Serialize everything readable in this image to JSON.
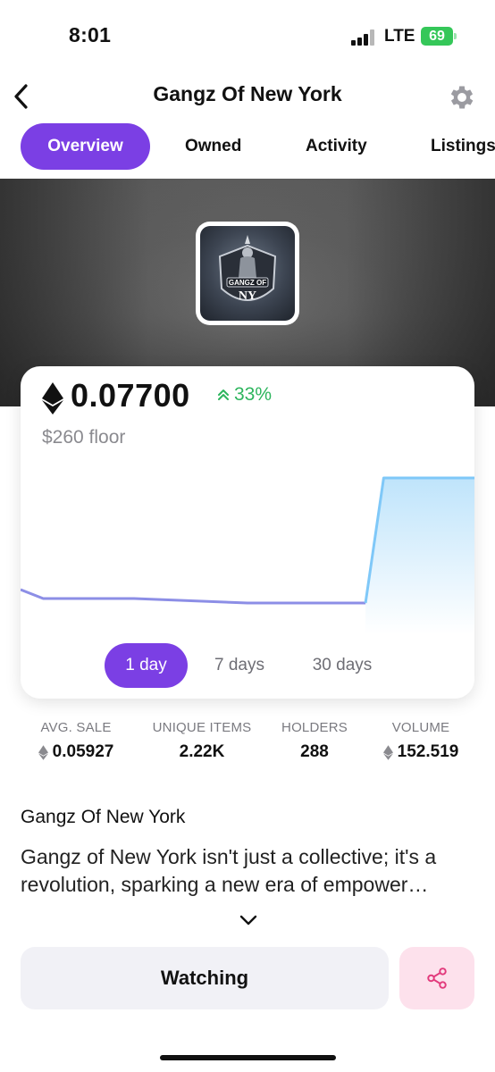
{
  "status_bar": {
    "time": "8:01",
    "network": "LTE",
    "battery": "69"
  },
  "header": {
    "title": "Gangz Of New York",
    "back_icon": "chevron-left-icon",
    "settings_icon": "gear-icon"
  },
  "tabs": [
    {
      "label": "Overview",
      "active": true
    },
    {
      "label": "Owned",
      "active": false
    },
    {
      "label": "Activity",
      "active": false
    },
    {
      "label": "Listings",
      "active": false
    }
  ],
  "collection": {
    "logo_text_line1": "GANGZ OF",
    "logo_text_line2": "NY"
  },
  "price": {
    "currency_icon": "ethereum-icon",
    "value": "0.07700",
    "change": "33%",
    "change_direction": "up",
    "change_color": "#2db55d",
    "floor_usd": "$260 floor"
  },
  "chart_data": {
    "type": "area",
    "x": [
      0,
      0.05,
      0.25,
      0.5,
      0.76,
      0.8,
      1.0
    ],
    "y": [
      0.0745,
      0.0743,
      0.0743,
      0.0742,
      0.0742,
      0.077,
      0.077
    ],
    "title": "",
    "xlabel": "",
    "ylabel": "",
    "grid": false,
    "colors": {
      "line": "#7fc8f8",
      "flat_line": "#8c8ee6",
      "fill_top": "#bfe4fb",
      "fill_bottom": "#ffffff"
    }
  },
  "ranges": [
    {
      "label": "1 day",
      "active": true
    },
    {
      "label": "7 days",
      "active": false
    },
    {
      "label": "30 days",
      "active": false
    }
  ],
  "stats": [
    {
      "label": "AVG. SALE",
      "value": "0.05927",
      "eth": true
    },
    {
      "label": "UNIQUE ITEMS",
      "value": "2.22K",
      "eth": false
    },
    {
      "label": "HOLDERS",
      "value": "288",
      "eth": false
    },
    {
      "label": "VOLUME",
      "value": "152.519",
      "eth": true
    }
  ],
  "description": {
    "title": "Gangz Of New York",
    "text": "Gangz of New York isn't just a collective; it's a revolution, sparking a new era of empower…",
    "expand_icon": "chevron-down-icon"
  },
  "actions": {
    "watch_label": "Watching",
    "share_icon": "share-icon"
  },
  "colors": {
    "accent": "#7b3fe4",
    "share_bg": "#fde1ec",
    "share_icon": "#e23a7c",
    "watch_bg": "#f1f1f6"
  }
}
